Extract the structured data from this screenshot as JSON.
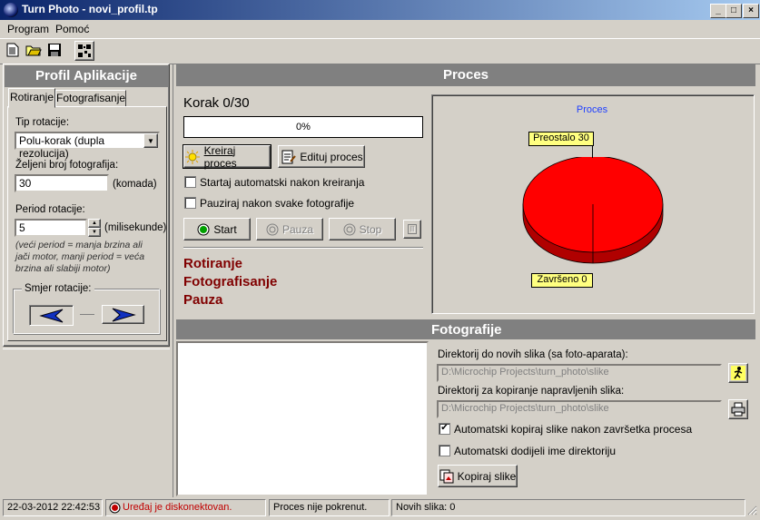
{
  "window": {
    "title": "Turn Photo - novi_profil.tp",
    "buttons": [
      "_",
      "□",
      "×"
    ]
  },
  "menu": [
    "Program",
    "Pomoć"
  ],
  "toolbar": [
    "new-file-icon",
    "open-folder-icon",
    "save-icon",
    "qr-code-icon"
  ],
  "left_panel": {
    "header": "Profil Aplikacije",
    "tabs": [
      "Rotiranje",
      "Fotografisanje"
    ],
    "tip_rotacije_label": "Tip rotacije:",
    "tip_rotacije_value": "Polu-korak (dupla rezolucija)",
    "broj_label": "Željeni broj fotografija:",
    "broj_value": "30",
    "broj_unit": "(komada)",
    "period_label": "Period rotacije:",
    "period_value": "5",
    "period_unit": "(milisekunde)",
    "note": "(veći period = manja brzina ali jači motor, manji period = veća brzina ali slabiji motor)",
    "smjer_label": "Smjer rotacije:"
  },
  "proces": {
    "header": "Proces",
    "korak": "Korak 0/30",
    "progress_text": "0%",
    "progress": 0,
    "kreiraj": "Kreiraj proces",
    "edituj": "Edituj proces",
    "chk_startaj": "Startaj automatski nakon kreiranja",
    "chk_pauziraj": "Pauziraj nakon svake fotografije",
    "start": "Start",
    "pauza": "Pauza",
    "stop": "Stop",
    "stages": [
      "Rotiranje",
      "Fotografisanje",
      "Pauza"
    ]
  },
  "pie": {
    "title": "Proces",
    "preostalo": "Preostalo 30",
    "zavrseno": "Završeno 0",
    "color": "#ff0000"
  },
  "fotografije": {
    "header": "Fotografije",
    "dir_novih_label": "Direktorij do novih slika (sa foto-aparata):",
    "dir_novih_value": "D:\\Microchip Projects\\turn_photo\\slike",
    "dir_kopiranje_label": "Direktorij za kopiranje napravljenih slika:",
    "dir_kopiranje_value": "D:\\Microchip Projects\\turn_photo\\slike",
    "chk_kopiraj": "Automatski kopiraj slike nakon završetka procesa",
    "chk_dodijeli": "Automatski dodijeli ime direktoriju",
    "kopiraj_btn": "Kopiraj slike"
  },
  "status": {
    "datetime": "22-03-2012 22:42:53",
    "device": "Uređaj je diskonektovan.",
    "proces": "Proces nije pokrenut.",
    "novih": "Novih slika: 0"
  }
}
